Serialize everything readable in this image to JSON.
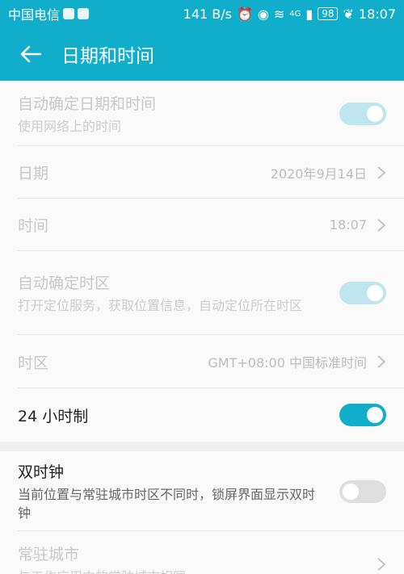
{
  "status_bar": {
    "carrier": "中国电信",
    "speed": "141 B/s",
    "network": "4G",
    "battery": "98",
    "time": "18:07"
  },
  "app_bar": {
    "title": "日期和时间"
  },
  "colors": {
    "accent": "#11aecb",
    "toggle_on": "#11aecb",
    "toggle_on_disabled": "#bfe6ee",
    "toggle_off": "#dedede"
  },
  "items": {
    "auto_datetime": {
      "label": "自动确定日期和时间",
      "desc": "使用网络上的时间",
      "toggle": "on",
      "disabled": true
    },
    "date": {
      "label": "日期",
      "value": "2020年9月14日",
      "disabled": true
    },
    "time": {
      "label": "时间",
      "value": "18:07",
      "disabled": true
    },
    "auto_timezone": {
      "label": "自动确定时区",
      "desc": "打开定位服务，获取位置信息，自动定位所在时区",
      "toggle": "on",
      "disabled": true
    },
    "timezone": {
      "label": "时区",
      "value": "GMT+08:00 中国标准时间",
      "disabled": true
    },
    "hour24": {
      "label": "24 小时制",
      "toggle": "on",
      "disabled": false
    },
    "dual_clock": {
      "label": "双时钟",
      "desc": "当前位置与常驻城市时区不同时，锁屏界面显示双时钟",
      "toggle": "off",
      "disabled": false
    },
    "home_city": {
      "label": "常驻城市",
      "desc": "与工作应用中的常驻城市相同",
      "disabled": true
    }
  }
}
